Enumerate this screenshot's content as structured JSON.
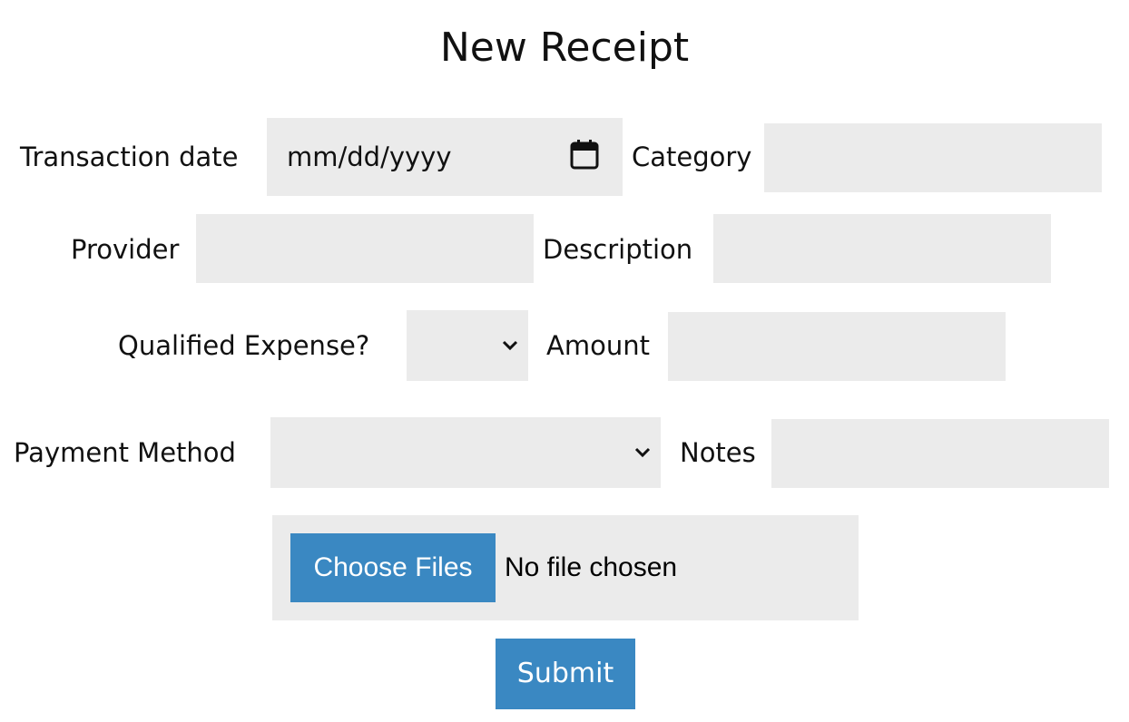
{
  "form": {
    "title": "New Receipt",
    "fields": {
      "transaction_date": {
        "label": "Transaction date",
        "placeholder": "mm/dd/yyyy",
        "icon": "calendar-icon"
      },
      "category": {
        "label": "Category",
        "value": ""
      },
      "provider": {
        "label": "Provider",
        "value": ""
      },
      "description": {
        "label": "Description",
        "value": ""
      },
      "qualified_expense": {
        "label": "Qualified Expense?",
        "selected": ""
      },
      "amount": {
        "label": "Amount",
        "value": ""
      },
      "payment_method": {
        "label": "Payment Method",
        "selected": ""
      },
      "notes": {
        "label": "Notes",
        "value": ""
      }
    },
    "file_upload": {
      "button_label": "Choose Files",
      "status": "No file chosen"
    },
    "submit_label": "Submit"
  },
  "colors": {
    "accent": "#3a88c2",
    "field_background": "#ebebeb",
    "text": "#111111"
  }
}
